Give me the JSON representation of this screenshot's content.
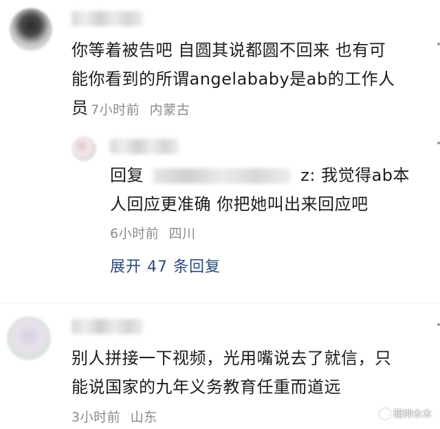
{
  "comments": [
    {
      "text_line1": "你等着被告吧 自圆其说都圆不回来 也有可",
      "text_line2": "能你看到的所谓angelababy是ab的工作人",
      "text_line3": "员",
      "time": "7小时前",
      "location": "内蒙古"
    },
    {
      "reply_prefix": "回复",
      "reply_suffix": "z: 我觉得ab本",
      "text_line2": "人回应更准确 你把她叫出来回应吧",
      "time": "6小时前",
      "location": "四川"
    },
    {
      "text_line1": "别人拼接一下视频，光用嘴说去了就信，只",
      "text_line2": "能说国家的九年义务教育任重而道远",
      "time": "3小时前",
      "location": "山东"
    }
  ],
  "expand_replies": "展开 47 条回复",
  "watermark": "萌神木木"
}
